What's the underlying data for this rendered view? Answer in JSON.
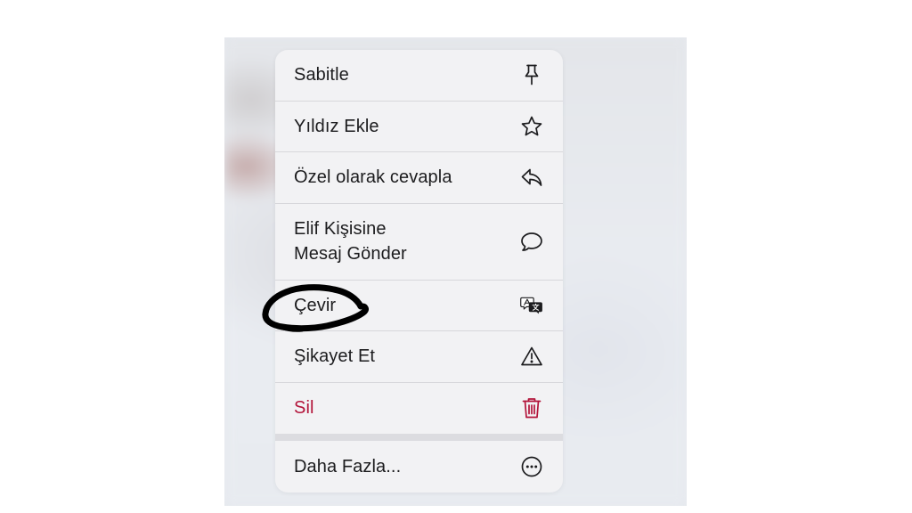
{
  "context_menu": {
    "items": [
      {
        "label": "Sabitle",
        "icon": "pin-icon"
      },
      {
        "label": "Yıldız Ekle",
        "icon": "star-icon"
      },
      {
        "label": "Özel olarak cevapla",
        "icon": "reply-icon"
      },
      {
        "label": "Elif Kişisine\nMesaj Gönder",
        "icon": "chat-bubble-icon"
      },
      {
        "label": "Çevir",
        "icon": "translate-icon"
      },
      {
        "label": "Şikayet Et",
        "icon": "warning-icon"
      },
      {
        "label": "Sil",
        "icon": "trash-icon",
        "color": "#b3143a"
      }
    ],
    "more": {
      "label": "Daha Fazla...",
      "icon": "more-icon"
    }
  },
  "annotation": {
    "type": "hand-drawn-circle",
    "color": "#000000",
    "target": "Çevir"
  }
}
